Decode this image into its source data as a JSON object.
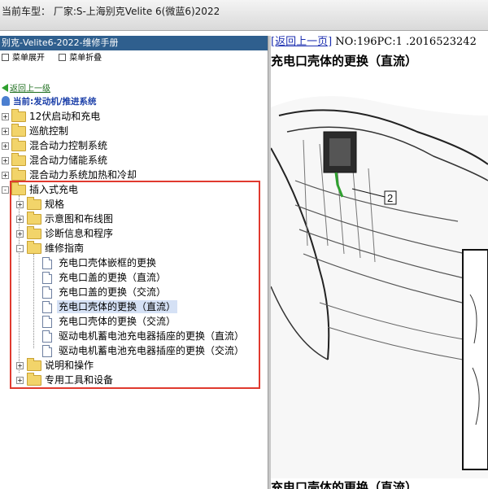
{
  "window": {
    "title": "当前车型：  厂家:S-上海别克Velite 6(微蓝6)2022"
  },
  "left_panel": {
    "header": "别克-Velite6-2022-维修手册",
    "menu": [
      {
        "label": "菜单展开"
      },
      {
        "label": "菜单折叠"
      }
    ],
    "back_link": "返回上一级",
    "current": "当前:发动机/推进系统"
  },
  "tree": {
    "top": [
      {
        "label": "12伏启动和充电",
        "toggle": "+"
      },
      {
        "label": "巡航控制",
        "toggle": "+"
      },
      {
        "label": "混合动力控制系统",
        "toggle": "+"
      },
      {
        "label": "混合动力储能系统",
        "toggle": "+"
      },
      {
        "label": "混合动力系统加热和冷却",
        "toggle": "+"
      }
    ],
    "plugin": {
      "label": "插入式充电",
      "toggle": "-",
      "children": [
        {
          "label": "规格",
          "toggle": "+"
        },
        {
          "label": "示意图和布线图",
          "toggle": "+"
        },
        {
          "label": "诊断信息和程序",
          "toggle": "+"
        }
      ],
      "repair": {
        "label": "维修指南",
        "toggle": "-",
        "docs": [
          {
            "label": "充电口壳体嵌框的更换"
          },
          {
            "label": "充电口盖的更换（直流）"
          },
          {
            "label": "充电口盖的更换（交流）"
          },
          {
            "label": "充电口壳体的更换（直流）",
            "selected": true
          },
          {
            "label": "充电口壳体的更换（交流）"
          },
          {
            "label": "驱动电机蓄电池充电器插座的更换（直流）"
          },
          {
            "label": "驱动电机蓄电池充电器插座的更换（交流）"
          }
        ]
      },
      "after": [
        {
          "label": "说明和操作",
          "toggle": "+"
        },
        {
          "label": "专用工具和设备",
          "toggle": "+"
        }
      ]
    }
  },
  "doc_view": {
    "back_link": "[返回上一页]",
    "meta": " NO:196PC:1 .2016523242",
    "title": "充电口壳体的更换（直流）",
    "illustration_callout": "2",
    "footer_title": "充电口壳体的更换（直流）"
  },
  "colors": {
    "header_bg": "#2f5f8e",
    "highlight_box": "#e03a2f",
    "link": "#1c2fb0",
    "selection": "#d5e1f5"
  }
}
